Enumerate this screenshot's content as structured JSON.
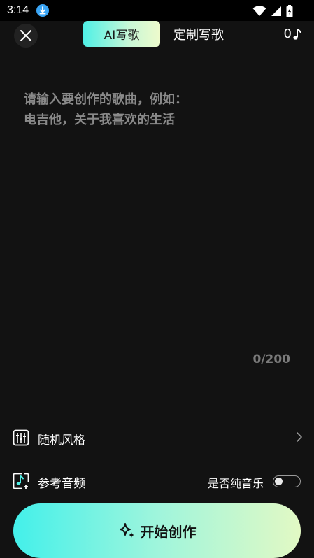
{
  "status_bar": {
    "time": "3:14"
  },
  "header": {
    "tabs": [
      {
        "label": "AI写歌",
        "active": true
      },
      {
        "label": "定制写歌",
        "active": false
      }
    ],
    "note_count": "0"
  },
  "editor": {
    "placeholder_line1": "请输入要创作的歌曲，例如：",
    "placeholder_line2": "电吉他，关于我喜欢的生活",
    "counter": "0/200"
  },
  "options": {
    "style_label": "随机风格",
    "reference_label": "参考音频",
    "pure_music_label": "是否纯音乐",
    "pure_music_enabled": false
  },
  "start_button": {
    "label": "开始创作"
  },
  "colors": {
    "background": "#121212",
    "accent_start": "#43f0ea",
    "accent_end": "#e2f9c4",
    "download_badge": "#3aa5f5"
  },
  "icons": {
    "close": "close-icon",
    "note": "music-note-icon",
    "style": "equalizer-icon",
    "reference": "music-file-add-icon",
    "chevron": "chevron-right-icon",
    "sparkle": "sparkle-icon"
  }
}
